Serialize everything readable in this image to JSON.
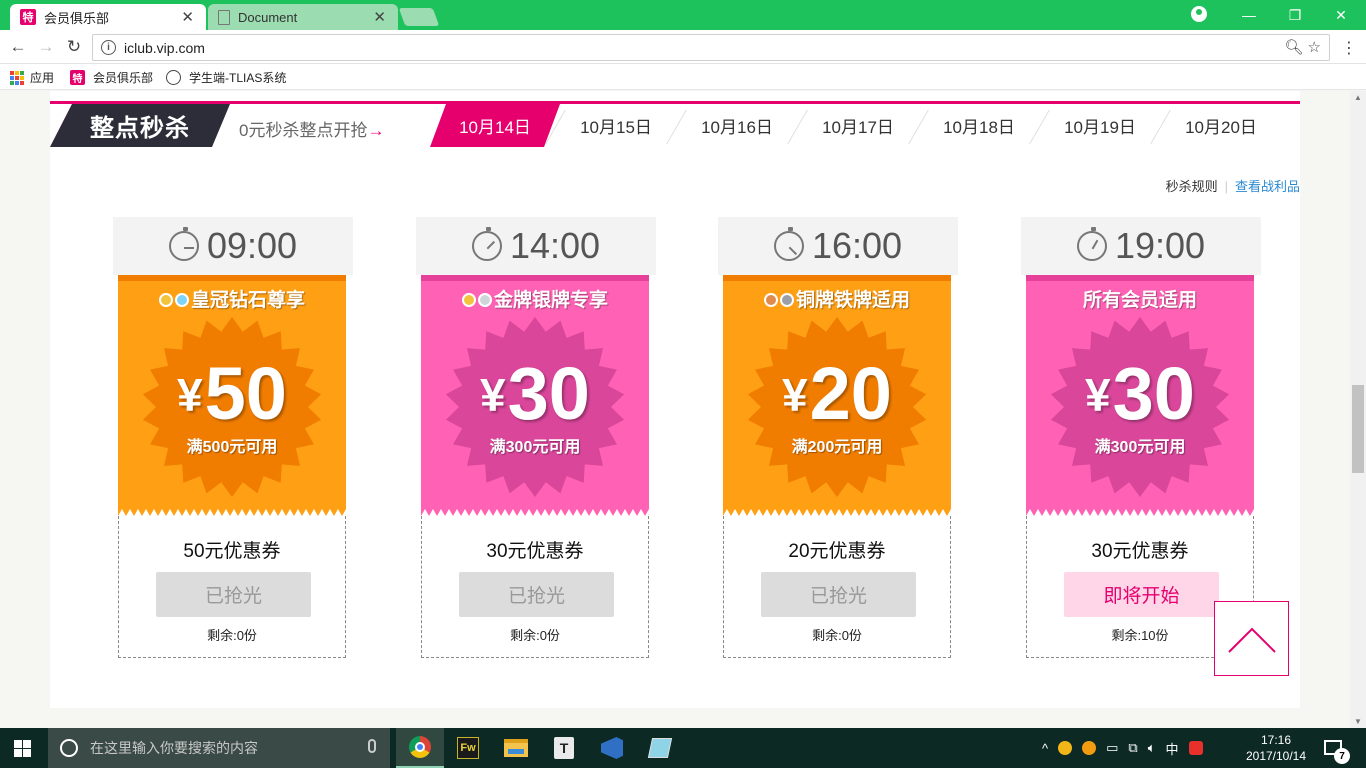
{
  "browser": {
    "tabs": [
      {
        "title": "会员俱乐部",
        "favicon": "特",
        "active": true
      },
      {
        "title": "Document",
        "active": false
      }
    ],
    "url": "iclub.vip.com",
    "bookmarks": [
      {
        "label": "应用"
      },
      {
        "label": "会员俱乐部",
        "favicon": "特"
      },
      {
        "label": "学生端-TLIAS系统"
      }
    ]
  },
  "header": {
    "title": "整点秒杀",
    "subtitle": "0元秒杀整点开抢",
    "subtitle_arrow": "→",
    "dates": [
      "10月14日",
      "10月15日",
      "10月16日",
      "10月17日",
      "10月18日",
      "10月19日",
      "10月20日"
    ],
    "active_date_index": 0
  },
  "links": {
    "rules": "秒杀规则",
    "separator": "|",
    "spoils": "查看战利品"
  },
  "coupons": [
    {
      "time": "09:00",
      "tier": "皇冠钻石尊享",
      "yen": "¥",
      "amount": "50",
      "condition": "满500元可用",
      "name": "50元优惠券",
      "button": "已抢光",
      "remaining": "剩余:0份",
      "theme": "orange",
      "status": "sold"
    },
    {
      "time": "14:00",
      "tier": "金牌银牌专享",
      "yen": "¥",
      "amount": "30",
      "condition": "满300元可用",
      "name": "30元优惠券",
      "button": "已抢光",
      "remaining": "剩余:0份",
      "theme": "pink",
      "status": "sold"
    },
    {
      "time": "16:00",
      "tier": "铜牌铁牌适用",
      "yen": "¥",
      "amount": "20",
      "condition": "满200元可用",
      "name": "20元优惠券",
      "button": "已抢光",
      "remaining": "剩余:0份",
      "theme": "orange",
      "status": "sold"
    },
    {
      "time": "19:00",
      "tier": "所有会员适用",
      "yen": "¥",
      "amount": "30",
      "condition": "满300元可用",
      "name": "30元优惠券",
      "button": "即将开始",
      "remaining": "剩余:10份",
      "theme": "pink",
      "status": "soon"
    }
  ],
  "colors": {
    "accent": "#e6006e",
    "orange": "#ff9f14",
    "pink": "#ff62b5",
    "link": "#2c8ad1",
    "chrome_green": "#1ec25d"
  },
  "taskbar": {
    "search_placeholder": "在这里输入你要搜索的内容",
    "ime": "中",
    "time": "17:16",
    "date": "2017/10/14",
    "notification_count": "7"
  }
}
